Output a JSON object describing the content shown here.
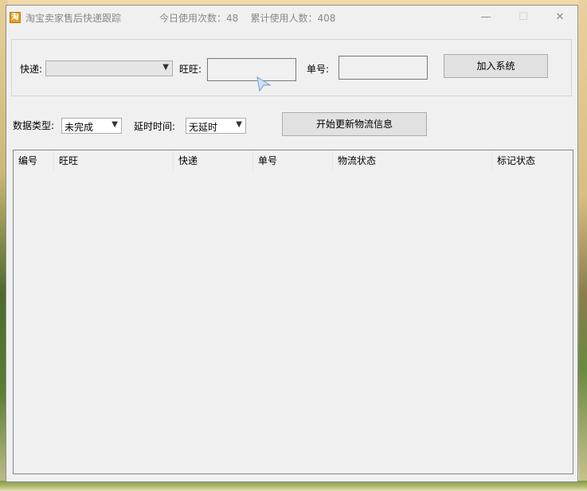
{
  "window": {
    "title": "淘宝卖家售后快递跟踪",
    "stats": "今日使用次数：48    累计使用人数：408",
    "icon": "taobao-app-icon",
    "icon_glyph": "淘",
    "controls": {
      "minimize": "—",
      "maximize": "☐",
      "close": "✕"
    }
  },
  "form": {
    "courier_label": "快递:",
    "courier_value": "",
    "wangwang_label": "旺旺:",
    "wangwang_value": "",
    "order_label": "单号:",
    "order_value": "",
    "add_button": "加入系统"
  },
  "filters": {
    "data_type_label": "数据类型:",
    "data_type_value": "未完成",
    "delay_label": "延时时间:",
    "delay_value": "无延时",
    "update_button": "开始更新物流信息"
  },
  "table": {
    "columns": [
      "编号",
      "旺旺",
      "快递",
      "单号",
      "物流状态",
      "标记状态"
    ],
    "rows": []
  }
}
